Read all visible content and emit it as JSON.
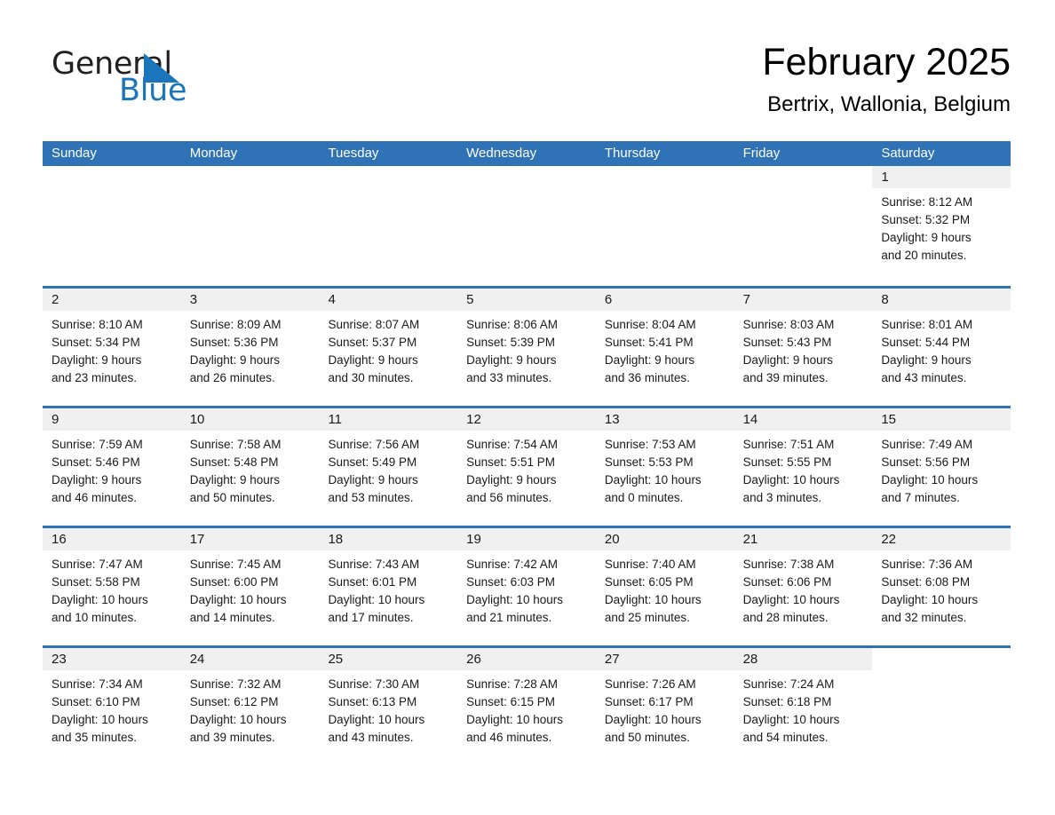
{
  "brand": {
    "name_part1": "General",
    "name_part2": "Blue",
    "logo_icon": "triangle-logo-icon"
  },
  "header": {
    "month_title": "February 2025",
    "location": "Bertrix, Wallonia, Belgium"
  },
  "colors": {
    "header_blue": "#2f72b6",
    "brand_blue": "#1b75bb",
    "day_band_grey": "#f0f0f0",
    "text": "#1a1a1a"
  },
  "weekdays": [
    "Sunday",
    "Monday",
    "Tuesday",
    "Wednesday",
    "Thursday",
    "Friday",
    "Saturday"
  ],
  "labels": {
    "sunrise_prefix": "Sunrise:",
    "sunset_prefix": "Sunset:",
    "daylight_prefix": "Daylight:"
  },
  "weeks": [
    [
      {
        "day": "",
        "sunrise": "",
        "sunset": "",
        "daylight_a": "",
        "daylight_b": "",
        "blank": true
      },
      {
        "day": "",
        "sunrise": "",
        "sunset": "",
        "daylight_a": "",
        "daylight_b": "",
        "blank": true
      },
      {
        "day": "",
        "sunrise": "",
        "sunset": "",
        "daylight_a": "",
        "daylight_b": "",
        "blank": true
      },
      {
        "day": "",
        "sunrise": "",
        "sunset": "",
        "daylight_a": "",
        "daylight_b": "",
        "blank": true
      },
      {
        "day": "",
        "sunrise": "",
        "sunset": "",
        "daylight_a": "",
        "daylight_b": "",
        "blank": true
      },
      {
        "day": "",
        "sunrise": "",
        "sunset": "",
        "daylight_a": "",
        "daylight_b": "",
        "blank": true
      },
      {
        "day": "1",
        "sunrise": "Sunrise: 8:12 AM",
        "sunset": "Sunset: 5:32 PM",
        "daylight_a": "Daylight: 9 hours",
        "daylight_b": "and 20 minutes.",
        "blank": false
      }
    ],
    [
      {
        "day": "2",
        "sunrise": "Sunrise: 8:10 AM",
        "sunset": "Sunset: 5:34 PM",
        "daylight_a": "Daylight: 9 hours",
        "daylight_b": "and 23 minutes.",
        "blank": false
      },
      {
        "day": "3",
        "sunrise": "Sunrise: 8:09 AM",
        "sunset": "Sunset: 5:36 PM",
        "daylight_a": "Daylight: 9 hours",
        "daylight_b": "and 26 minutes.",
        "blank": false
      },
      {
        "day": "4",
        "sunrise": "Sunrise: 8:07 AM",
        "sunset": "Sunset: 5:37 PM",
        "daylight_a": "Daylight: 9 hours",
        "daylight_b": "and 30 minutes.",
        "blank": false
      },
      {
        "day": "5",
        "sunrise": "Sunrise: 8:06 AM",
        "sunset": "Sunset: 5:39 PM",
        "daylight_a": "Daylight: 9 hours",
        "daylight_b": "and 33 minutes.",
        "blank": false
      },
      {
        "day": "6",
        "sunrise": "Sunrise: 8:04 AM",
        "sunset": "Sunset: 5:41 PM",
        "daylight_a": "Daylight: 9 hours",
        "daylight_b": "and 36 minutes.",
        "blank": false
      },
      {
        "day": "7",
        "sunrise": "Sunrise: 8:03 AM",
        "sunset": "Sunset: 5:43 PM",
        "daylight_a": "Daylight: 9 hours",
        "daylight_b": "and 39 minutes.",
        "blank": false
      },
      {
        "day": "8",
        "sunrise": "Sunrise: 8:01 AM",
        "sunset": "Sunset: 5:44 PM",
        "daylight_a": "Daylight: 9 hours",
        "daylight_b": "and 43 minutes.",
        "blank": false
      }
    ],
    [
      {
        "day": "9",
        "sunrise": "Sunrise: 7:59 AM",
        "sunset": "Sunset: 5:46 PM",
        "daylight_a": "Daylight: 9 hours",
        "daylight_b": "and 46 minutes.",
        "blank": false
      },
      {
        "day": "10",
        "sunrise": "Sunrise: 7:58 AM",
        "sunset": "Sunset: 5:48 PM",
        "daylight_a": "Daylight: 9 hours",
        "daylight_b": "and 50 minutes.",
        "blank": false
      },
      {
        "day": "11",
        "sunrise": "Sunrise: 7:56 AM",
        "sunset": "Sunset: 5:49 PM",
        "daylight_a": "Daylight: 9 hours",
        "daylight_b": "and 53 minutes.",
        "blank": false
      },
      {
        "day": "12",
        "sunrise": "Sunrise: 7:54 AM",
        "sunset": "Sunset: 5:51 PM",
        "daylight_a": "Daylight: 9 hours",
        "daylight_b": "and 56 minutes.",
        "blank": false
      },
      {
        "day": "13",
        "sunrise": "Sunrise: 7:53 AM",
        "sunset": "Sunset: 5:53 PM",
        "daylight_a": "Daylight: 10 hours",
        "daylight_b": "and 0 minutes.",
        "blank": false
      },
      {
        "day": "14",
        "sunrise": "Sunrise: 7:51 AM",
        "sunset": "Sunset: 5:55 PM",
        "daylight_a": "Daylight: 10 hours",
        "daylight_b": "and 3 minutes.",
        "blank": false
      },
      {
        "day": "15",
        "sunrise": "Sunrise: 7:49 AM",
        "sunset": "Sunset: 5:56 PM",
        "daylight_a": "Daylight: 10 hours",
        "daylight_b": "and 7 minutes.",
        "blank": false
      }
    ],
    [
      {
        "day": "16",
        "sunrise": "Sunrise: 7:47 AM",
        "sunset": "Sunset: 5:58 PM",
        "daylight_a": "Daylight: 10 hours",
        "daylight_b": "and 10 minutes.",
        "blank": false
      },
      {
        "day": "17",
        "sunrise": "Sunrise: 7:45 AM",
        "sunset": "Sunset: 6:00 PM",
        "daylight_a": "Daylight: 10 hours",
        "daylight_b": "and 14 minutes.",
        "blank": false
      },
      {
        "day": "18",
        "sunrise": "Sunrise: 7:43 AM",
        "sunset": "Sunset: 6:01 PM",
        "daylight_a": "Daylight: 10 hours",
        "daylight_b": "and 17 minutes.",
        "blank": false
      },
      {
        "day": "19",
        "sunrise": "Sunrise: 7:42 AM",
        "sunset": "Sunset: 6:03 PM",
        "daylight_a": "Daylight: 10 hours",
        "daylight_b": "and 21 minutes.",
        "blank": false
      },
      {
        "day": "20",
        "sunrise": "Sunrise: 7:40 AM",
        "sunset": "Sunset: 6:05 PM",
        "daylight_a": "Daylight: 10 hours",
        "daylight_b": "and 25 minutes.",
        "blank": false
      },
      {
        "day": "21",
        "sunrise": "Sunrise: 7:38 AM",
        "sunset": "Sunset: 6:06 PM",
        "daylight_a": "Daylight: 10 hours",
        "daylight_b": "and 28 minutes.",
        "blank": false
      },
      {
        "day": "22",
        "sunrise": "Sunrise: 7:36 AM",
        "sunset": "Sunset: 6:08 PM",
        "daylight_a": "Daylight: 10 hours",
        "daylight_b": "and 32 minutes.",
        "blank": false
      }
    ],
    [
      {
        "day": "23",
        "sunrise": "Sunrise: 7:34 AM",
        "sunset": "Sunset: 6:10 PM",
        "daylight_a": "Daylight: 10 hours",
        "daylight_b": "and 35 minutes.",
        "blank": false
      },
      {
        "day": "24",
        "sunrise": "Sunrise: 7:32 AM",
        "sunset": "Sunset: 6:12 PM",
        "daylight_a": "Daylight: 10 hours",
        "daylight_b": "and 39 minutes.",
        "blank": false
      },
      {
        "day": "25",
        "sunrise": "Sunrise: 7:30 AM",
        "sunset": "Sunset: 6:13 PM",
        "daylight_a": "Daylight: 10 hours",
        "daylight_b": "and 43 minutes.",
        "blank": false
      },
      {
        "day": "26",
        "sunrise": "Sunrise: 7:28 AM",
        "sunset": "Sunset: 6:15 PM",
        "daylight_a": "Daylight: 10 hours",
        "daylight_b": "and 46 minutes.",
        "blank": false
      },
      {
        "day": "27",
        "sunrise": "Sunrise: 7:26 AM",
        "sunset": "Sunset: 6:17 PM",
        "daylight_a": "Daylight: 10 hours",
        "daylight_b": "and 50 minutes.",
        "blank": false
      },
      {
        "day": "28",
        "sunrise": "Sunrise: 7:24 AM",
        "sunset": "Sunset: 6:18 PM",
        "daylight_a": "Daylight: 10 hours",
        "daylight_b": "and 54 minutes.",
        "blank": false
      },
      {
        "day": "",
        "sunrise": "",
        "sunset": "",
        "daylight_a": "",
        "daylight_b": "",
        "blank": true
      }
    ]
  ]
}
